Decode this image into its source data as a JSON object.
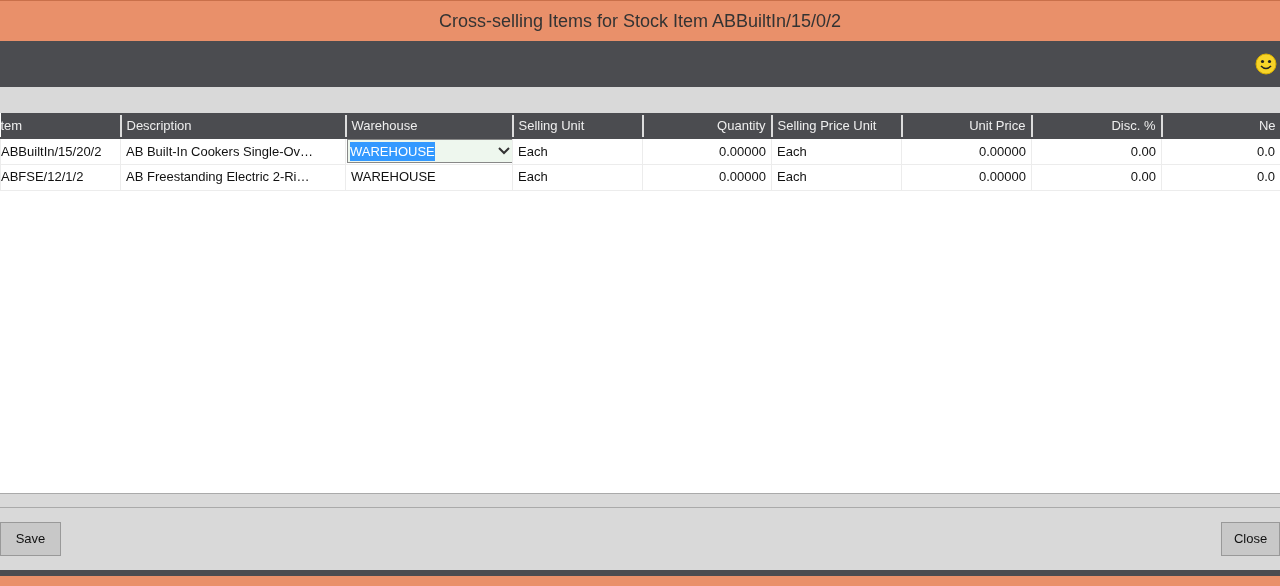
{
  "window": {
    "title": "Cross-selling Items for Stock Item ABBuiltIn/15/0/2"
  },
  "table": {
    "columns": [
      {
        "label": "tem",
        "kind": "text"
      },
      {
        "label": "Description",
        "kind": "text"
      },
      {
        "label": "Warehouse",
        "kind": "text"
      },
      {
        "label": "Selling Unit",
        "kind": "text"
      },
      {
        "label": "Quantity",
        "kind": "number"
      },
      {
        "label": "Selling Price Unit",
        "kind": "text"
      },
      {
        "label": "Unit Price",
        "kind": "number"
      },
      {
        "label": "Disc. %",
        "kind": "number"
      },
      {
        "label": "Ne",
        "kind": "number"
      }
    ],
    "rows": [
      {
        "warehouse_editing": true,
        "cells": [
          "ABBuiltIn/15/20/2",
          "AB Built-In Cookers Single-Ov…",
          "WAREHOUSE",
          "Each",
          "0.00000",
          "Each",
          "0.00000",
          "0.00",
          "0.0"
        ]
      },
      {
        "warehouse_editing": false,
        "cells": [
          "ABFSE/12/1/2",
          "AB Freestanding Electric 2-Ri…",
          "WAREHOUSE",
          "Each",
          "0.00000",
          "Each",
          "0.00000",
          "0.00",
          "0.0"
        ]
      }
    ]
  },
  "buttons": [
    {
      "label": "Save",
      "kind": "left"
    },
    {
      "label": "Close",
      "kind": "right"
    }
  ]
}
